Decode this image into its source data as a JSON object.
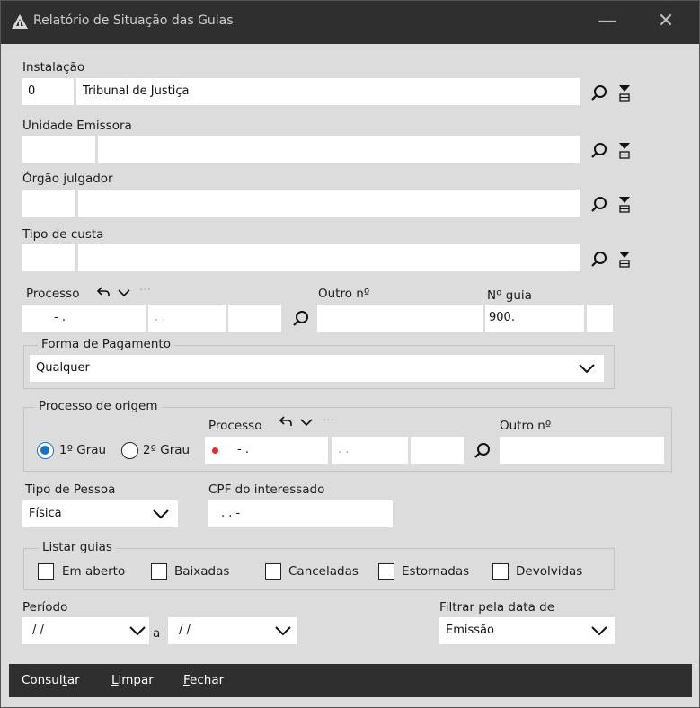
{
  "window": {
    "title": "Relatório de Situação das Guias",
    "minimize_symbol": "—",
    "close_symbol": "✕"
  },
  "instalacao": {
    "label": "Instalação",
    "code": "0",
    "name": "Tribunal de Justiça"
  },
  "unidade_emissora": {
    "label": "Unidade Emissora",
    "code": "",
    "name": ""
  },
  "orgao_julgador": {
    "label": "Órgão julgador",
    "code": "",
    "name": ""
  },
  "tipo_custa": {
    "label": "Tipo de custa",
    "code": "",
    "name": ""
  },
  "processo": {
    "label": "Processo",
    "part1": "- .",
    "part2": ". .",
    "part3": "",
    "outro_label": "Outro nº",
    "outro_value": "",
    "guia_label": "Nº guia",
    "guia_value": "900.",
    "guia_extra": ""
  },
  "forma_pagamento": {
    "legend": "Forma de Pagamento",
    "selected": "Qualquer"
  },
  "processo_origem": {
    "legend": "Processo de origem",
    "processo_label": "Processo",
    "grau1_label": "1º Grau",
    "grau2_label": "2º Grau",
    "selected_grau": "1",
    "part1": "- .",
    "part2": ". .",
    "part3": "",
    "outro_label": "Outro nº",
    "outro_value": ""
  },
  "tipo_pessoa": {
    "label": "Tipo de Pessoa",
    "selected": "Física"
  },
  "cpf": {
    "label": "CPF do interessado",
    "value": ". . -"
  },
  "listar_guias": {
    "legend": "Listar guias",
    "options": [
      {
        "label": "Em aberto",
        "checked": false
      },
      {
        "label": "Baixadas",
        "checked": false
      },
      {
        "label": "Canceladas",
        "checked": false
      },
      {
        "label": "Estornadas",
        "checked": false
      },
      {
        "label": "Devolvidas",
        "checked": false
      }
    ]
  },
  "periodo": {
    "label": "Período",
    "start": "/ /",
    "separator": "a",
    "end": "/ /"
  },
  "filtrar_data": {
    "label": "Filtrar pela data de",
    "selected": "Emissão"
  },
  "actions": {
    "consultar_pre": "Consul",
    "consultar_key": "t",
    "consultar_post": "ar",
    "limpar_key": "L",
    "limpar_rest": "impar",
    "fechar_key": "F",
    "fechar_rest": "echar"
  },
  "colors": {
    "titlebar": "#2f2f2f",
    "body": "#dcdcdc",
    "accent": "#1a73c9",
    "required_dot": "#e02b2b"
  },
  "icons": [
    "app-logo-icon",
    "minimize-icon",
    "close-icon",
    "search-icon",
    "clear-filter-icon",
    "undo-icon",
    "chevron-down-icon",
    "more-icon"
  ]
}
